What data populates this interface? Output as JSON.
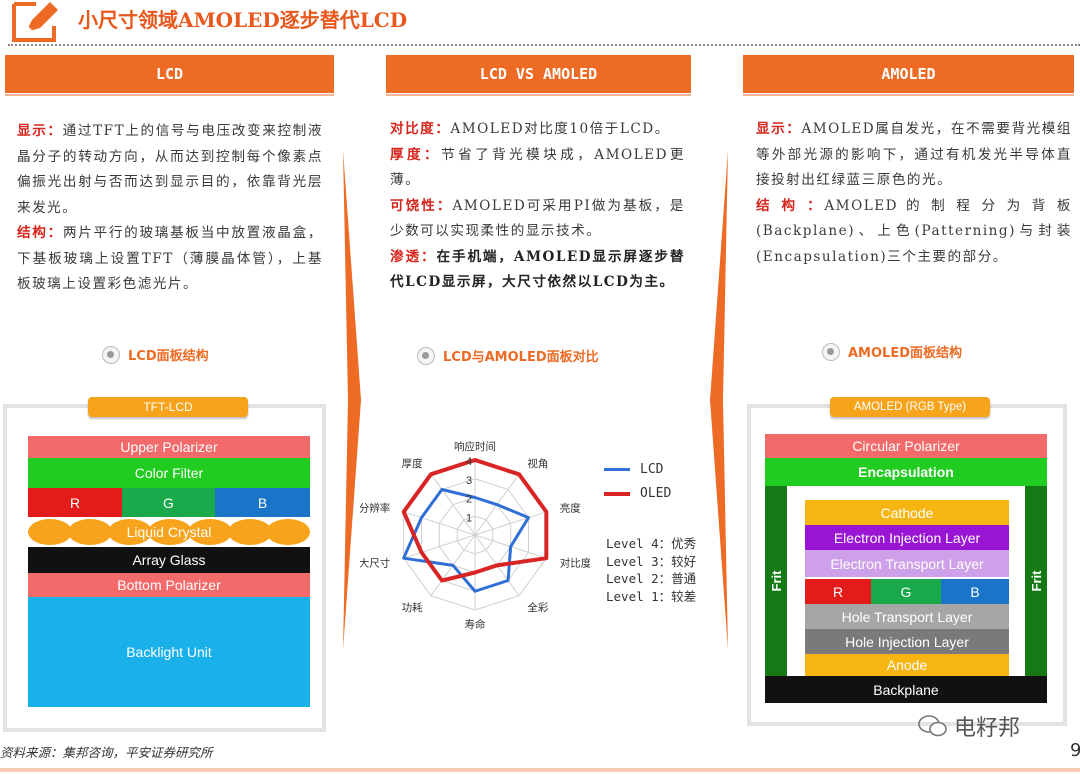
{
  "header": {
    "title": "小尺寸领域AMOLED逐步替代LCD"
  },
  "columns": {
    "lcd": {
      "header": "LCD",
      "display_key": "显示：",
      "display_text": "通过TFT上的信号与电压改变来控制液晶分子的转动方向，从而达到控制每个像素点偏振光出射与否而达到显示目的，依靠背光层来发光。",
      "structure_key": "结构：",
      "structure_text": "两片平行的玻璃基板当中放置液晶盒，下基板玻璃上设置TFT（薄膜晶体管），上基板玻璃上设置彩色滤光片。",
      "section_label": "LCD面板结构"
    },
    "compare": {
      "header": "LCD VS AMOLED",
      "contrast_key": "对比度：",
      "contrast_text": "AMOLED对比度10倍于LCD。",
      "thickness_key": "厚度：",
      "thickness_text": "节省了背光模块成，AMOLED更薄。",
      "flex_key": "可饶性：",
      "flex_text": "AMOLED可采用PI做为基板，是少数可以实现柔性的显示技术。",
      "pen_key": "渗透：",
      "pen_text": "在手机端，AMOLED显示屏逐步替代LCD显示屏，大尺寸依然以LCD为主。",
      "section_label": "LCD与AMOLED面板对比"
    },
    "amoled": {
      "header": "AMOLED",
      "display_key": "显示：",
      "display_text": "AMOLED属自发光，在不需要背光模组等外部光源的影响下，通过有机发光半导体直接投射出红绿蓝三原色的光。",
      "structure_key": "结 构 ：",
      "structure_text": "AMOLED 的 制 程 分 为 背 板(Backplane)、上色(Patterning)与封装(Encapsulation)三个主要的部分。",
      "section_label": "AMOLED面板结构"
    }
  },
  "lcd_stack": {
    "tag": "TFT-LCD",
    "layers": {
      "upper_polarizer": "Upper Polarizer",
      "color_filter": "Color Filter",
      "r": "R",
      "g": "G",
      "b": "B",
      "liquid_crystal": "Liquid Crystal",
      "array_glass": "Array Glass",
      "bottom_polarizer": "Bottom Polarizer",
      "backlight": "Backlight Unit"
    }
  },
  "amoled_stack": {
    "tag": "AMOLED (RGB Type)",
    "layers": {
      "circular_polarizer": "Circular Polarizer",
      "encapsulation": "Encapsulation",
      "cathode": "Cathode",
      "eil": "Electron Injection Layer",
      "etl": "Electron Transport Layer",
      "r": "R",
      "g": "G",
      "b": "B",
      "htl": "Hole Transport Layer",
      "hil": "Hole Injection Layer",
      "anode": "Anode",
      "backplane": "Backplane",
      "frit": "Frit"
    }
  },
  "chart_data": {
    "type": "radar",
    "axes": [
      "响应时间",
      "视角",
      "亮度",
      "对比度",
      "全彩",
      "寿命",
      "功耗",
      "大尺寸",
      "高分辨率",
      "厚度"
    ],
    "ticks": [
      "1",
      "2",
      "3",
      "4"
    ],
    "range": [
      0,
      4
    ],
    "series": [
      {
        "name": "LCD",
        "color": "#2f6fd6",
        "values": [
          2,
          2,
          3,
          2,
          3,
          3,
          2,
          4,
          3,
          3
        ]
      },
      {
        "name": "OLED",
        "color": "#d82424",
        "values": [
          4,
          4,
          4,
          4,
          2,
          2,
          3,
          3,
          4,
          4
        ]
      }
    ],
    "levels": [
      "Level 4：优秀",
      "Level 3：较好",
      "Level 2：普通",
      "Level 1：较差"
    ]
  },
  "footer": {
    "source": "资料来源：集邦咨询，平安证券研究所",
    "watermark": "电籽邦",
    "page": "9"
  },
  "colors": {
    "accent": "#ed6b24",
    "keyword": "#d7261e"
  }
}
